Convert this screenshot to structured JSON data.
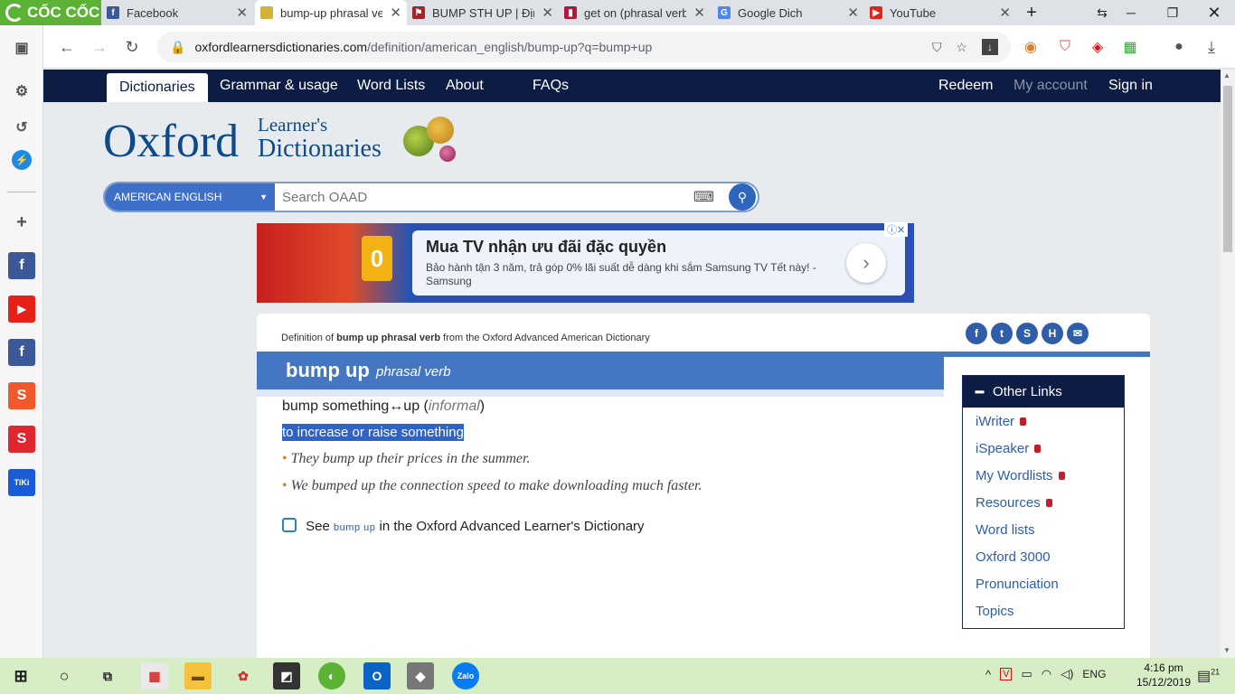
{
  "browser": {
    "brand": "CỐC CỐC",
    "tabs": [
      {
        "title": "Facebook",
        "icon": "facebook-icon",
        "active": false
      },
      {
        "title": "bump-up phrasal ver",
        "icon": "oxford-icon",
        "active": true
      },
      {
        "title": "BUMP STH UP | Định",
        "icon": "cambridge-icon",
        "active": false
      },
      {
        "title": "get on (phrasal verb)",
        "icon": "book-icon",
        "active": false
      },
      {
        "title": "Google Dich",
        "icon": "google-translate-icon",
        "active": false
      },
      {
        "title": "YouTube",
        "icon": "youtube-icon",
        "active": false
      }
    ],
    "url_host": "oxfordlearnersdictionaries.com",
    "url_path": "/definition/american_english/bump-up?q=bump+up"
  },
  "nav": {
    "items": [
      "Dictionaries",
      "Grammar & usage",
      "Word Lists",
      "About",
      "FAQs"
    ],
    "right": [
      "Redeem",
      "My account",
      "Sign in"
    ]
  },
  "logo": {
    "oxford": "Oxford",
    "learners": "Learner's",
    "dictionaries": "Dictionaries"
  },
  "search": {
    "dictionary": "AMERICAN ENGLISH",
    "placeholder": "Search OAAD"
  },
  "ad": {
    "title": "Mua TV nhận ưu đãi đặc quyền",
    "body": "Bảo hành tận 3 năm, trả góp 0% lãi suất dễ dàng khi sắm Samsung TV Tết này! - Samsung",
    "badge": "0"
  },
  "entry": {
    "definition_of_prefix": "Definition of",
    "definition_of_word": "bump up phrasal verb",
    "definition_of_suffix": "from the Oxford Advanced American Dictionary",
    "headword": "bump up",
    "pos": "phrasal verb",
    "sense_head": "bump something↔up",
    "register": "informal",
    "definition": "to increase or raise something",
    "examples": [
      "They bump up their prices in the summer.",
      "We bumped up the connection speed to make downloading much faster."
    ],
    "see_prefix": "See",
    "see_word": "bump up",
    "see_suffix": "in the Oxford Advanced Learner's Dictionary"
  },
  "other_links": {
    "title": "Other Links",
    "items": [
      {
        "label": "iWriter",
        "locked": true
      },
      {
        "label": "iSpeaker",
        "locked": true
      },
      {
        "label": "My Wordlists",
        "locked": true
      },
      {
        "label": "Resources",
        "locked": true
      },
      {
        "label": "Word lists",
        "locked": false
      },
      {
        "label": "Oxford 3000",
        "locked": false
      },
      {
        "label": "Pronunciation",
        "locked": false
      },
      {
        "label": "Topics",
        "locked": false
      }
    ]
  },
  "taskbar": {
    "lang": "ENG",
    "time": "4:16 pm",
    "date": "15/12/2019",
    "notifications": "21"
  },
  "colors": {
    "nav": "#0d1c44",
    "accent": "#4476c2",
    "coccoc": "#5bb234"
  }
}
